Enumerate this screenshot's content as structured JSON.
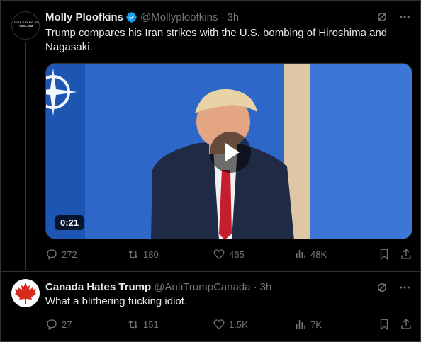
{
  "posts": [
    {
      "author": "Molly Ploofkins",
      "handle": "@Mollyploofkins",
      "separator": "·",
      "time": "3h",
      "verified": true,
      "avatar_text": "JUST SAY NO TO FASCISM",
      "text": "Trump compares his Iran strikes with the U.S. bombing of Hiroshima and Nagasaki.",
      "video": {
        "duration": "0:21"
      },
      "stats": {
        "replies": "272",
        "reposts": "180",
        "likes": "465",
        "views": "48K"
      }
    },
    {
      "author": "Canada Hates Trump",
      "handle": "@AntiTrumpCanada",
      "separator": "·",
      "time": "3h",
      "verified": false,
      "text": "What a blithering fucking idiot.",
      "stats": {
        "replies": "27",
        "reposts": "151",
        "likes": "1.5K",
        "views": "7K"
      }
    }
  ],
  "colors": {
    "background": "#000000",
    "text": "#e7e9ea",
    "muted": "#71767b",
    "verified": "#1d9bf0",
    "border": "#2f3336"
  },
  "icons": [
    "grok-icon",
    "more-icon",
    "reply-icon",
    "repost-icon",
    "like-icon",
    "views-icon",
    "bookmark-icon",
    "share-icon",
    "verified-badge-icon",
    "play-icon",
    "maple-leaf-icon"
  ]
}
